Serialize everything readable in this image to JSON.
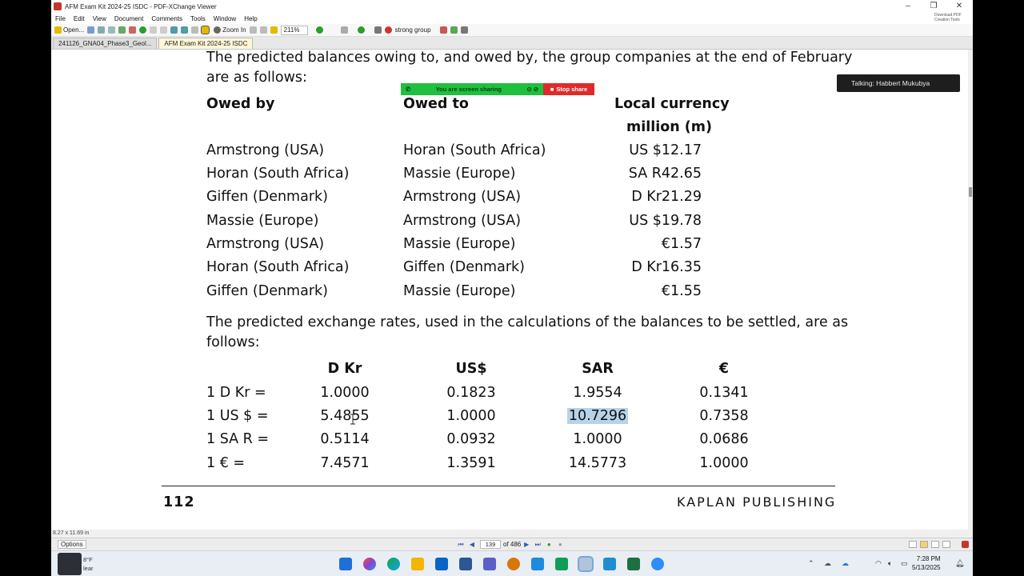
{
  "window": {
    "title": "AFM Exam Kit 2024-25 ISDC - PDF-XChange Viewer",
    "minimize": "–",
    "restore": "❐",
    "close": "✕",
    "download_badge": "Download PDF Creation Tools"
  },
  "menu": [
    "File",
    "Edit",
    "View",
    "Document",
    "Comments",
    "Tools",
    "Window",
    "Help"
  ],
  "toolbar": {
    "open_label": "Open...",
    "zoom_in_label": "Zoom In",
    "zoom_value": "211%",
    "search_value": "strong group"
  },
  "tabs": [
    {
      "label": "241126_GNA04_Phase3_Geol..."
    },
    {
      "label": "AFM Exam Kit 2024-25 ISDC"
    }
  ],
  "screen_share": {
    "banner_text": "You are screen sharing",
    "stop_label": "Stop share",
    "talking_text": "Talking: Habbert Mukubya"
  },
  "document": {
    "intro": "The predicted balances owing to, and owed by, the group companies at the end of February",
    "intro2": "are as follows:",
    "balances_headers": {
      "owed_by": "Owed by",
      "owed_to": "Owed to",
      "currency1": "Local currency",
      "currency2": "million (m)"
    },
    "balances": [
      {
        "owed_by": "Armstrong (USA)",
        "owed_to": "Horan (South Africa)",
        "amount": "US $12.17"
      },
      {
        "owed_by": "Horan (South Africa)",
        "owed_to": "Massie (Europe)",
        "amount": "SA R42.65"
      },
      {
        "owed_by": "Giffen (Denmark)",
        "owed_to": "Armstrong (USA)",
        "amount": "D Kr21.29"
      },
      {
        "owed_by": "Massie (Europe)",
        "owed_to": "Armstrong (USA)",
        "amount": "US $19.78"
      },
      {
        "owed_by": "Armstrong (USA)",
        "owed_to": "Massie (Europe)",
        "amount": "€1.57"
      },
      {
        "owed_by": "Horan (South Africa)",
        "owed_to": "Giffen (Denmark)",
        "amount": "D Kr16.35"
      },
      {
        "owed_by": "Giffen (Denmark)",
        "owed_to": "Massie (Europe)",
        "amount": "€1.55"
      }
    ],
    "rates_intro": "The predicted exchange rates, used in the calculations of the balances to be settled, are as",
    "rates_intro2": "follows:",
    "rates_headers": [
      "D Kr",
      "US$",
      "SAR",
      "€"
    ],
    "rates": [
      {
        "label": "1 D Kr =",
        "values": [
          "1.0000",
          "0.1823",
          "1.9554",
          "0.1341"
        ]
      },
      {
        "label": "1 US $ =",
        "values": [
          "5.4855",
          "1.0000",
          "10.7296",
          "0.7358"
        ]
      },
      {
        "label": "1 SA R =",
        "values": [
          "0.5114",
          "0.0932",
          "1.0000",
          "0.0686"
        ]
      },
      {
        "label": "1 € =",
        "values": [
          "7.4571",
          "1.3591",
          "14.5773",
          "1.0000"
        ]
      }
    ],
    "highlighted_value": "10.7296",
    "page_number": "112",
    "publisher": "KAPLAN PUBLISHING"
  },
  "status": {
    "page_size": "8.27 x 11.69 in",
    "options_label": "Options",
    "current_page": "139",
    "page_total": "of 486"
  },
  "taskbar": {
    "weather_temp": "8°F",
    "weather_cond": "lear",
    "time": "7:28 PM",
    "date": "5/13/2025"
  }
}
